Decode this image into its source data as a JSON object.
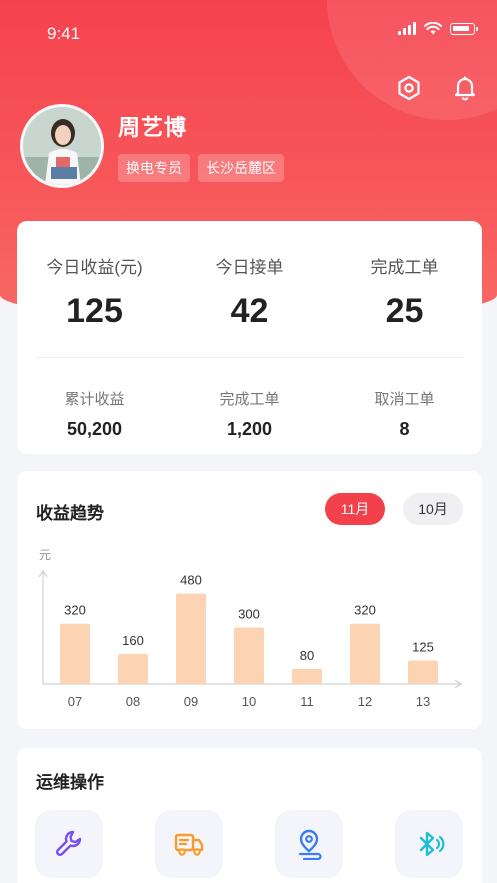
{
  "status_bar": {
    "time": "9:41"
  },
  "profile": {
    "name": "周艺博",
    "tags": [
      "换电专员",
      "长沙岳麓区"
    ]
  },
  "today_stats": [
    {
      "label": "今日收益(元)",
      "value": "125"
    },
    {
      "label": "今日接单",
      "value": "42"
    },
    {
      "label": "完成工单",
      "value": "25"
    }
  ],
  "total_stats": [
    {
      "label": "累计收益",
      "value": "50,200"
    },
    {
      "label": "完成工单",
      "value": "1,200"
    },
    {
      "label": "取消工单",
      "value": "8"
    }
  ],
  "trend": {
    "title": "收益趋势",
    "months": [
      {
        "label": "11月",
        "active": true
      },
      {
        "label": "10月",
        "active": false
      }
    ]
  },
  "chart_data": {
    "type": "bar",
    "ylabel": "元",
    "categories": [
      "07",
      "08",
      "09",
      "10",
      "11",
      "12",
      "13"
    ],
    "values": [
      320,
      160,
      480,
      300,
      80,
      320,
      125
    ],
    "ylim": [
      0,
      600
    ],
    "bar_color": "#fdd4b3"
  },
  "ops": {
    "title": "运维操作",
    "items": [
      {
        "icon": "wrench-icon",
        "color": "#7b4ef2"
      },
      {
        "icon": "truck-icon",
        "color": "#f89b2a"
      },
      {
        "icon": "location-route-icon",
        "color": "#3a7bf5"
      },
      {
        "icon": "bluetooth-icon",
        "color": "#20bcd3"
      }
    ]
  },
  "colors": {
    "accent": "#f2414a",
    "header": "#f5424f"
  }
}
